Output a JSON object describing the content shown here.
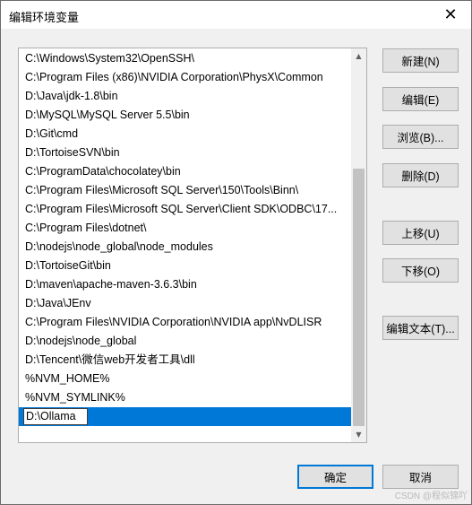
{
  "window": {
    "title": "编辑环境变量",
    "close_glyph": "✕"
  },
  "list": {
    "items": [
      "C:\\Windows\\System32\\OpenSSH\\",
      "C:\\Program Files (x86)\\NVIDIA Corporation\\PhysX\\Common",
      "D:\\Java\\jdk-1.8\\bin",
      "D:\\MySQL\\MySQL Server 5.5\\bin",
      "D:\\Git\\cmd",
      "D:\\TortoiseSVN\\bin",
      "C:\\ProgramData\\chocolatey\\bin",
      "C:\\Program Files\\Microsoft SQL Server\\150\\Tools\\Binn\\",
      "C:\\Program Files\\Microsoft SQL Server\\Client SDK\\ODBC\\17...",
      "C:\\Program Files\\dotnet\\",
      "D:\\nodejs\\node_global\\node_modules",
      "D:\\TortoiseGit\\bin",
      "D:\\maven\\apache-maven-3.6.3\\bin",
      "D:\\Java\\JEnv",
      "C:\\Program Files\\NVIDIA Corporation\\NVIDIA app\\NvDLISR",
      "D:\\nodejs\\node_global",
      "D:\\Tencent\\微信web开发者工具\\dll",
      "%NVM_HOME%",
      "%NVM_SYMLINK%"
    ],
    "editing_value": "D:\\Ollama"
  },
  "buttons": {
    "new": "新建(N)",
    "edit": "编辑(E)",
    "browse": "浏览(B)...",
    "delete": "删除(D)",
    "move_up": "上移(U)",
    "move_down": "下移(O)",
    "edit_text": "编辑文本(T)...",
    "ok": "确定",
    "cancel": "取消"
  },
  "scrollbar": {
    "up_glyph": "▲",
    "down_glyph": "▼"
  },
  "watermark": "CSDN @程似锦吖",
  "colors": {
    "selection": "#0078d7",
    "default_button_border": "#0078d7"
  }
}
